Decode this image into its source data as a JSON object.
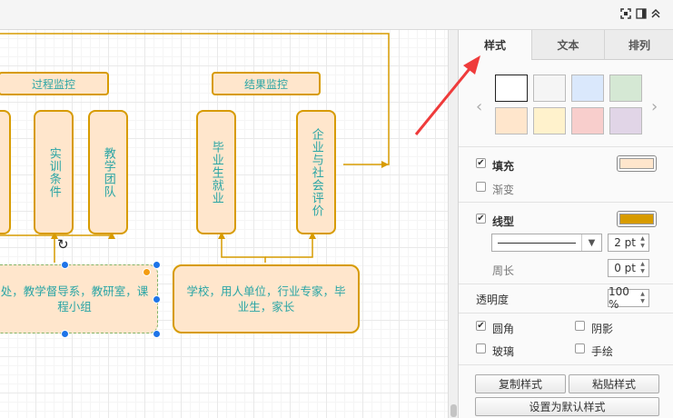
{
  "toolbar": {
    "fullscreen_icon": "fullscreen-icon",
    "panel_icon": "panel-toggle-icon",
    "collapse_icon": "chevron-up-double-icon"
  },
  "canvas": {
    "labels": {
      "process": "过程监控",
      "result": "结果监控"
    },
    "columns": {
      "training": "实训条件",
      "teaching": "教学团队",
      "employment": "毕业生就业",
      "evaluation": "企业与社会评价"
    },
    "bottom_left": "处，教学督导系，教研室，课程小组",
    "bottom_right": "学校，用人单位，行业专家，毕业生，家长",
    "colors": {
      "fill": "#ffe6cc",
      "stroke": "#d79b00",
      "text": "#2aa5a5",
      "selection": "#1e74e8"
    }
  },
  "panel": {
    "tabs": [
      "样式",
      "文本",
      "排列"
    ],
    "active_tab": "样式",
    "swatches": [
      "#ffffff",
      "#f5f5f5",
      "#dae8fc",
      "#d5e8d4",
      "#ffe6cc",
      "#fff2cc",
      "#f8cecc",
      "#e1d5e7"
    ],
    "fill": {
      "label": "填充",
      "checked": true,
      "color": "#ffe6cc"
    },
    "gradient": {
      "label": "渐变",
      "checked": false
    },
    "line": {
      "label": "线型",
      "checked": true,
      "color": "#d79b00",
      "width": "2 pt"
    },
    "perimeter": {
      "label": "周长",
      "value": "0 pt"
    },
    "opacity": {
      "label": "透明度",
      "value": "100 %"
    },
    "rounded": {
      "label": "圆角",
      "checked": true
    },
    "shadow": {
      "label": "阴影",
      "checked": false
    },
    "glass": {
      "label": "玻璃",
      "checked": false
    },
    "sketch": {
      "label": "手绘",
      "checked": false
    },
    "buttons": {
      "copy": "复制样式",
      "paste": "粘贴样式",
      "default": "设置为默认样式"
    },
    "check_mark": "✔"
  }
}
